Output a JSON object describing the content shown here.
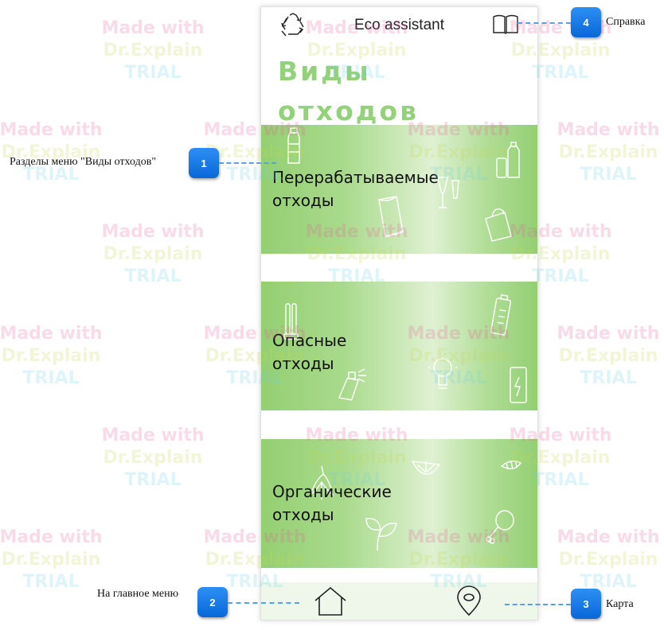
{
  "app": {
    "title": "Eco assistant",
    "heading_line1": "Виды",
    "heading_line2": "отходов"
  },
  "cards": [
    {
      "line1": "Перерабатываемые",
      "line2": "отходы"
    },
    {
      "line1": "Опасные",
      "line2": "отходы"
    },
    {
      "line1": "Органические",
      "line2": "отходы"
    }
  ],
  "icons": {
    "top_left": "recycle-icon",
    "top_right": "book-icon",
    "bottom_left": "home-icon",
    "bottom_right": "map-pin-icon"
  },
  "callouts": [
    {
      "number": "1",
      "text": "Разделы меню \"Виды отходов\""
    },
    {
      "number": "2",
      "text": "На главное меню"
    },
    {
      "number": "3",
      "text": "Карта"
    },
    {
      "number": "4",
      "text": "Справка"
    }
  ],
  "watermark": {
    "line1": "Made with",
    "line2": "Dr.Explain",
    "line3": "TRIAL"
  },
  "colors": {
    "heading": "#93d27a",
    "card_green": "#94cf72",
    "badge": "#1178e6",
    "bottom_bar": "#eef7ea"
  }
}
